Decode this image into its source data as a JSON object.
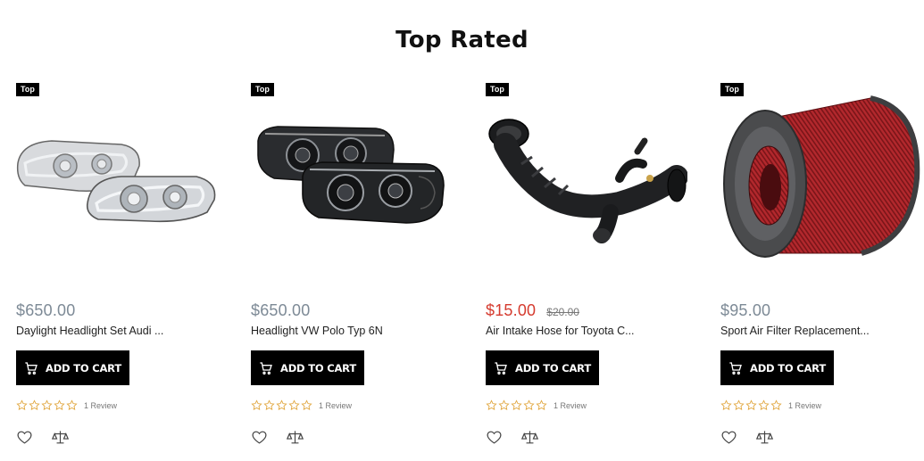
{
  "section": {
    "title": "Top Rated"
  },
  "colors": {
    "sale_price": "#d53b2f",
    "regular_price": "#7d8a96",
    "button_bg": "#000000",
    "star": "#e0a43a"
  },
  "products": [
    {
      "badge": "Top",
      "price": "$650.00",
      "old_price": "",
      "title": "Daylight Headlight Set Audi ...",
      "button": "ADD TO CART",
      "reviews": "1 Review",
      "rating": 0,
      "image": "headlight-set-chrome"
    },
    {
      "badge": "Top",
      "price": "$650.00",
      "old_price": "",
      "title": "Headlight VW Polo Typ 6N",
      "button": "ADD TO CART",
      "reviews": "1 Review",
      "rating": 0,
      "image": "headlight-set-black"
    },
    {
      "badge": "Top",
      "price": "$15.00",
      "old_price": "$20.00",
      "title": "Air Intake Hose for Toyota C...",
      "button": "ADD TO CART",
      "reviews": "1 Review",
      "rating": 0,
      "image": "air-intake-hose"
    },
    {
      "badge": "Top",
      "price": "$95.00",
      "old_price": "",
      "title": "Sport Air Filter Replacement...",
      "button": "ADD TO CART",
      "reviews": "1 Review",
      "rating": 0,
      "image": "air-filter-red"
    }
  ]
}
